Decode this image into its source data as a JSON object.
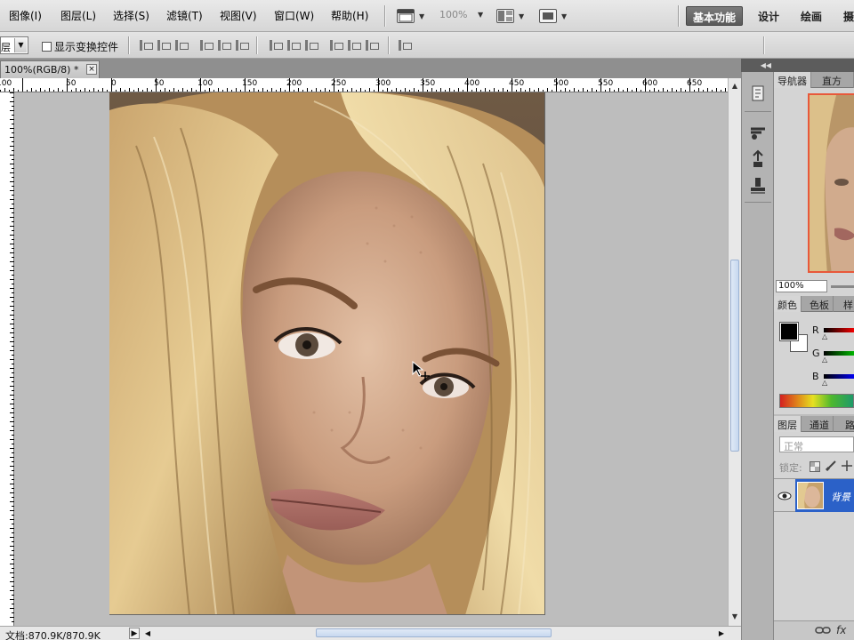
{
  "menubar": {
    "items": [
      {
        "label": "图像(I)"
      },
      {
        "label": "图层(L)"
      },
      {
        "label": "选择(S)"
      },
      {
        "label": "滤镜(T)"
      },
      {
        "label": "视图(V)"
      },
      {
        "label": "窗口(W)"
      },
      {
        "label": "帮助(H)"
      }
    ],
    "zoom": "100%",
    "workspaces": {
      "essentials": "基本功能",
      "design": "设计",
      "painting": "绘画",
      "photography": "摄"
    }
  },
  "options": {
    "select_value": "层",
    "show_transform_controls": "显示变换控件",
    "show_transform_checked": false
  },
  "document": {
    "tab_title": "100%(RGB/8) *",
    "close_glyph": "×"
  },
  "ruler": {
    "labels": [
      "100",
      "50",
      "0",
      "50",
      "100",
      "150",
      "200",
      "250",
      "300",
      "350",
      "400",
      "450",
      "500",
      "550",
      "600",
      "650"
    ]
  },
  "status": {
    "doc_size": "文档:870.9K/870.9K"
  },
  "panels": {
    "navigator": {
      "tabs": [
        "导航器",
        "直方图"
      ],
      "zoom": "100%"
    },
    "color": {
      "tabs": [
        "颜色",
        "色板",
        "样"
      ],
      "channels": [
        "R",
        "G",
        "B"
      ],
      "fg": "#000000",
      "bg": "#ffffff"
    },
    "layers": {
      "tabs": [
        "图层",
        "通道",
        "路"
      ],
      "blend_mode": "正常",
      "lock_label": "锁定:",
      "layer_name": "背景"
    }
  },
  "colors": {
    "selection_blue": "#2b61c8",
    "nav_frame": "#e8583a"
  }
}
